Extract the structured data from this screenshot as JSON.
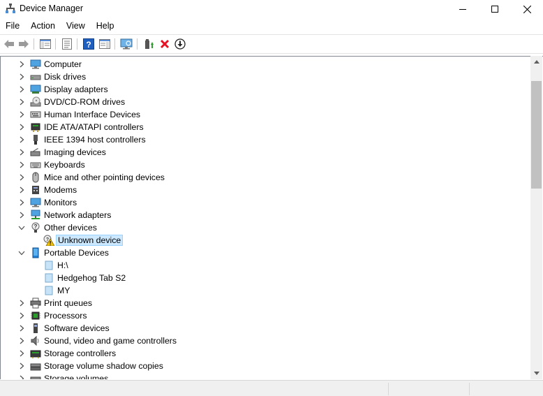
{
  "window": {
    "title": "Device Manager"
  },
  "menu": [
    "File",
    "Action",
    "View",
    "Help"
  ],
  "toolbar": [
    {
      "name": "back-icon"
    },
    {
      "name": "forward-icon"
    },
    {
      "name": "show-hide-console-tree-icon"
    },
    {
      "name": "properties-icon"
    },
    {
      "name": "help-icon"
    },
    {
      "name": "show-action-pane-icon"
    },
    {
      "name": "scan-hardware-changes-icon"
    },
    {
      "name": "update-driver-icon"
    },
    {
      "name": "uninstall-device-icon"
    },
    {
      "name": "download-driver-icon"
    }
  ],
  "tree": [
    {
      "label": "Computer",
      "level": 0,
      "state": "collapsed",
      "icon": "computer-icon"
    },
    {
      "label": "Disk drives",
      "level": 0,
      "state": "collapsed",
      "icon": "disk-drive-icon"
    },
    {
      "label": "Display adapters",
      "level": 0,
      "state": "collapsed",
      "icon": "display-adapter-icon"
    },
    {
      "label": "DVD/CD-ROM drives",
      "level": 0,
      "state": "collapsed",
      "icon": "dvd-drive-icon"
    },
    {
      "label": "Human Interface Devices",
      "level": 0,
      "state": "collapsed",
      "icon": "hid-icon"
    },
    {
      "label": "IDE ATA/ATAPI controllers",
      "level": 0,
      "state": "collapsed",
      "icon": "ide-controller-icon"
    },
    {
      "label": "IEEE 1394 host controllers",
      "level": 0,
      "state": "collapsed",
      "icon": "ieee1394-icon"
    },
    {
      "label": "Imaging devices",
      "level": 0,
      "state": "collapsed",
      "icon": "imaging-device-icon"
    },
    {
      "label": "Keyboards",
      "level": 0,
      "state": "collapsed",
      "icon": "keyboard-icon"
    },
    {
      "label": "Mice and other pointing devices",
      "level": 0,
      "state": "collapsed",
      "icon": "mouse-icon"
    },
    {
      "label": "Modems",
      "level": 0,
      "state": "collapsed",
      "icon": "modem-icon"
    },
    {
      "label": "Monitors",
      "level": 0,
      "state": "collapsed",
      "icon": "monitor-icon"
    },
    {
      "label": "Network adapters",
      "level": 0,
      "state": "collapsed",
      "icon": "network-adapter-icon"
    },
    {
      "label": "Other devices",
      "level": 0,
      "state": "expanded",
      "icon": "other-devices-icon"
    },
    {
      "label": "Unknown device",
      "level": 1,
      "state": "leaf",
      "icon": "unknown-device-warning-icon",
      "selected": true
    },
    {
      "label": "Portable Devices",
      "level": 0,
      "state": "expanded",
      "icon": "portable-device-icon"
    },
    {
      "label": "H:\\",
      "level": 1,
      "state": "leaf",
      "icon": "portable-item-icon"
    },
    {
      "label": "Hedgehog Tab S2",
      "level": 1,
      "state": "leaf",
      "icon": "portable-item-icon"
    },
    {
      "label": "MY",
      "level": 1,
      "state": "leaf",
      "icon": "portable-item-icon"
    },
    {
      "label": "Print queues",
      "level": 0,
      "state": "collapsed",
      "icon": "printer-icon"
    },
    {
      "label": "Processors",
      "level": 0,
      "state": "collapsed",
      "icon": "processor-icon"
    },
    {
      "label": "Software devices",
      "level": 0,
      "state": "collapsed",
      "icon": "software-device-icon"
    },
    {
      "label": "Sound, video and game controllers",
      "level": 0,
      "state": "collapsed",
      "icon": "sound-icon"
    },
    {
      "label": "Storage controllers",
      "level": 0,
      "state": "collapsed",
      "icon": "storage-controller-icon"
    },
    {
      "label": "Storage volume shadow copies",
      "level": 0,
      "state": "collapsed",
      "icon": "shadow-copy-icon"
    },
    {
      "label": "Storage volumes",
      "level": 0,
      "state": "collapsed",
      "icon": "storage-volume-icon"
    }
  ],
  "colors": {
    "selection_bg": "#cce8ff",
    "selection_border": "#99d1ff",
    "uninstall_red": "#e81123",
    "help_blue": "#1f5fbf"
  }
}
